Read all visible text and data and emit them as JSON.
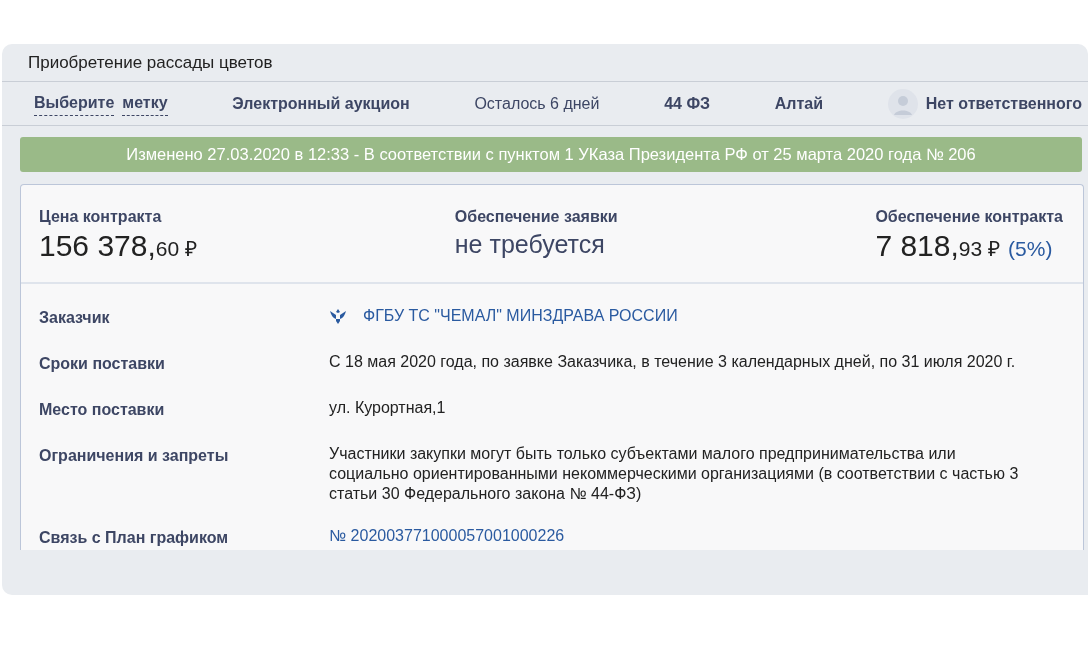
{
  "title": "Приобретение рассады цветов",
  "meta": [
    {
      "kind": "tag-picker",
      "words": [
        "Выберите",
        "метку"
      ]
    },
    {
      "kind": "text",
      "text": "Электронный аукцион",
      "bold": true
    },
    {
      "kind": "text",
      "text": "Осталось 6 дней",
      "bold": false
    },
    {
      "kind": "text",
      "text": "44 ФЗ",
      "bold": true
    },
    {
      "kind": "text",
      "text": "Алтай",
      "bold": true
    },
    {
      "kind": "person",
      "text": "Нет ответственного"
    }
  ],
  "banner": "Изменено 27.03.2020 в 12:33 - В соответствии с пунктом 1 УКаза Президента РФ от 25 марта 2020 года № 206",
  "summary": [
    {
      "label": "Цена контракта",
      "kind": "money",
      "main": "156 378,",
      "fraction": "60",
      "currency": "₽"
    },
    {
      "label": "Обеспечение заявки",
      "kind": "text",
      "text": "не требуется"
    },
    {
      "label": "Обеспечение контракта",
      "kind": "money",
      "main": "7 818,",
      "fraction": "93",
      "currency": "₽",
      "percent": "(5%)"
    }
  ],
  "details": [
    {
      "label": "Заказчик",
      "kind": "org-link",
      "value": "ФГБУ ТС \"ЧЕМАЛ\" МИНЗДРАВА РОССИИ"
    },
    {
      "label": "Сроки поставки",
      "kind": "text",
      "value": "С 18 мая 2020 года, по заявке Заказчика, в течение 3 календарных дней, по 31 июля 2020 г."
    },
    {
      "label": "Место поставки",
      "kind": "text",
      "value": "ул. Курортная,1"
    },
    {
      "label": "Ограничения и запреты",
      "kind": "text",
      "value": "Участники закупки могут быть только субъектами малого предпринимательства или социально ориентированными некоммерческими организациями (в соответствии с частью 3 статьи 30 Федерального закона № 44-ФЗ)"
    },
    {
      "label": "Связь с План графиком",
      "kind": "link",
      "value": "№ 202003771000057001000226"
    }
  ]
}
